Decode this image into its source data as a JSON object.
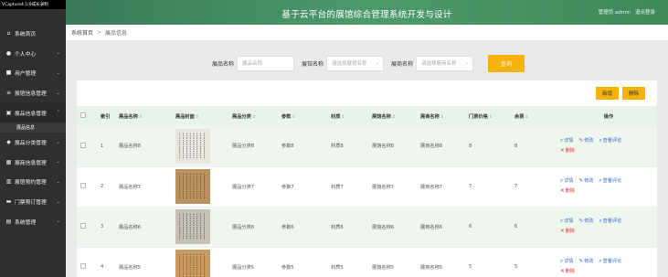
{
  "caption": "VCapture4.1(9成长录制",
  "app_title": "基于云平台的展馆综合管理系统开发与设计",
  "user_bar": {
    "role": "管理员 admin",
    "logout": "退出登录"
  },
  "breadcrumb": {
    "home": "系统首页",
    "sep": ">",
    "current": "展品信息"
  },
  "sidebar": {
    "items": [
      {
        "label": "系统首页",
        "icon": "home-icon",
        "glyph": "⌂",
        "chev": ""
      },
      {
        "label": "个人中心",
        "icon": "person-icon",
        "glyph": "●",
        "chev": "⌄"
      },
      {
        "label": "用户管理",
        "icon": "user-icon",
        "glyph": "■",
        "chev": "⌄"
      },
      {
        "label": "展馆信息管理",
        "icon": "list-icon",
        "glyph": "≡",
        "chev": "⌄"
      },
      {
        "label": "展品信息管理",
        "icon": "box-icon",
        "glyph": "▣",
        "chev": "⌃"
      }
    ],
    "sub_item": "展品信息",
    "items2": [
      {
        "label": "展品分类管理",
        "icon": "tag-icon",
        "glyph": "◆",
        "chev": "⌄"
      },
      {
        "label": "展商信息管理",
        "icon": "grid-icon",
        "glyph": "▦",
        "chev": "⌄"
      },
      {
        "label": "展馆预约管理",
        "icon": "chart-icon",
        "glyph": "▥",
        "chev": "⌄"
      },
      {
        "label": "门票预订管理",
        "icon": "ticket-icon",
        "glyph": "▬",
        "chev": "⌄"
      },
      {
        "label": "系统管理",
        "icon": "gear-icon",
        "glyph": "▤",
        "chev": "⌄"
      }
    ]
  },
  "search": {
    "label1": "展品名称",
    "ph1": "展品名称",
    "label2": "展馆名称",
    "ph2": "请选择展馆名称",
    "label3": "展商名称",
    "ph3": "请选择展商名称",
    "button": "查询"
  },
  "toolbar": {
    "add": "新增",
    "delete": "删除"
  },
  "columns": [
    "索引",
    "展品名称",
    "展品封面",
    "展品分类",
    "参数",
    "材质",
    "展馆名称",
    "展商名称",
    "门票价格",
    "余票",
    "操作"
  ],
  "actions": {
    "detail": "详情",
    "edit": "修改",
    "comments": "查看评论",
    "del": "删除"
  },
  "rows": [
    {
      "idx": "1",
      "name": "展品名称8",
      "cat": "展品分类8",
      "param": "参数8",
      "mat": "材质8",
      "hall": "展馆名称8",
      "vendor": "展商名称8",
      "price": "8",
      "left": "8"
    },
    {
      "idx": "2",
      "name": "展品名称7",
      "cat": "展品分类7",
      "param": "参数7",
      "mat": "材质7",
      "hall": "展馆名称7",
      "vendor": "展商名称7",
      "price": "7",
      "left": "7"
    },
    {
      "idx": "3",
      "name": "展品名称6",
      "cat": "展品分类6",
      "param": "参数6",
      "mat": "材质6",
      "hall": "展馆名称6",
      "vendor": "展商名称6",
      "price": "6",
      "left": "6"
    },
    {
      "idx": "4",
      "name": "展品名称5",
      "cat": "展品分类5",
      "param": "参数5",
      "mat": "材质5",
      "hall": "展馆名称5",
      "vendor": "展商名称5",
      "price": "5",
      "left": "5"
    }
  ],
  "colors": {
    "accent": "#f5b10c",
    "banner": "#4d9a6b",
    "sidebar": "#2f2f2f",
    "link": "#3a6cc5",
    "danger": "#dd3333"
  }
}
